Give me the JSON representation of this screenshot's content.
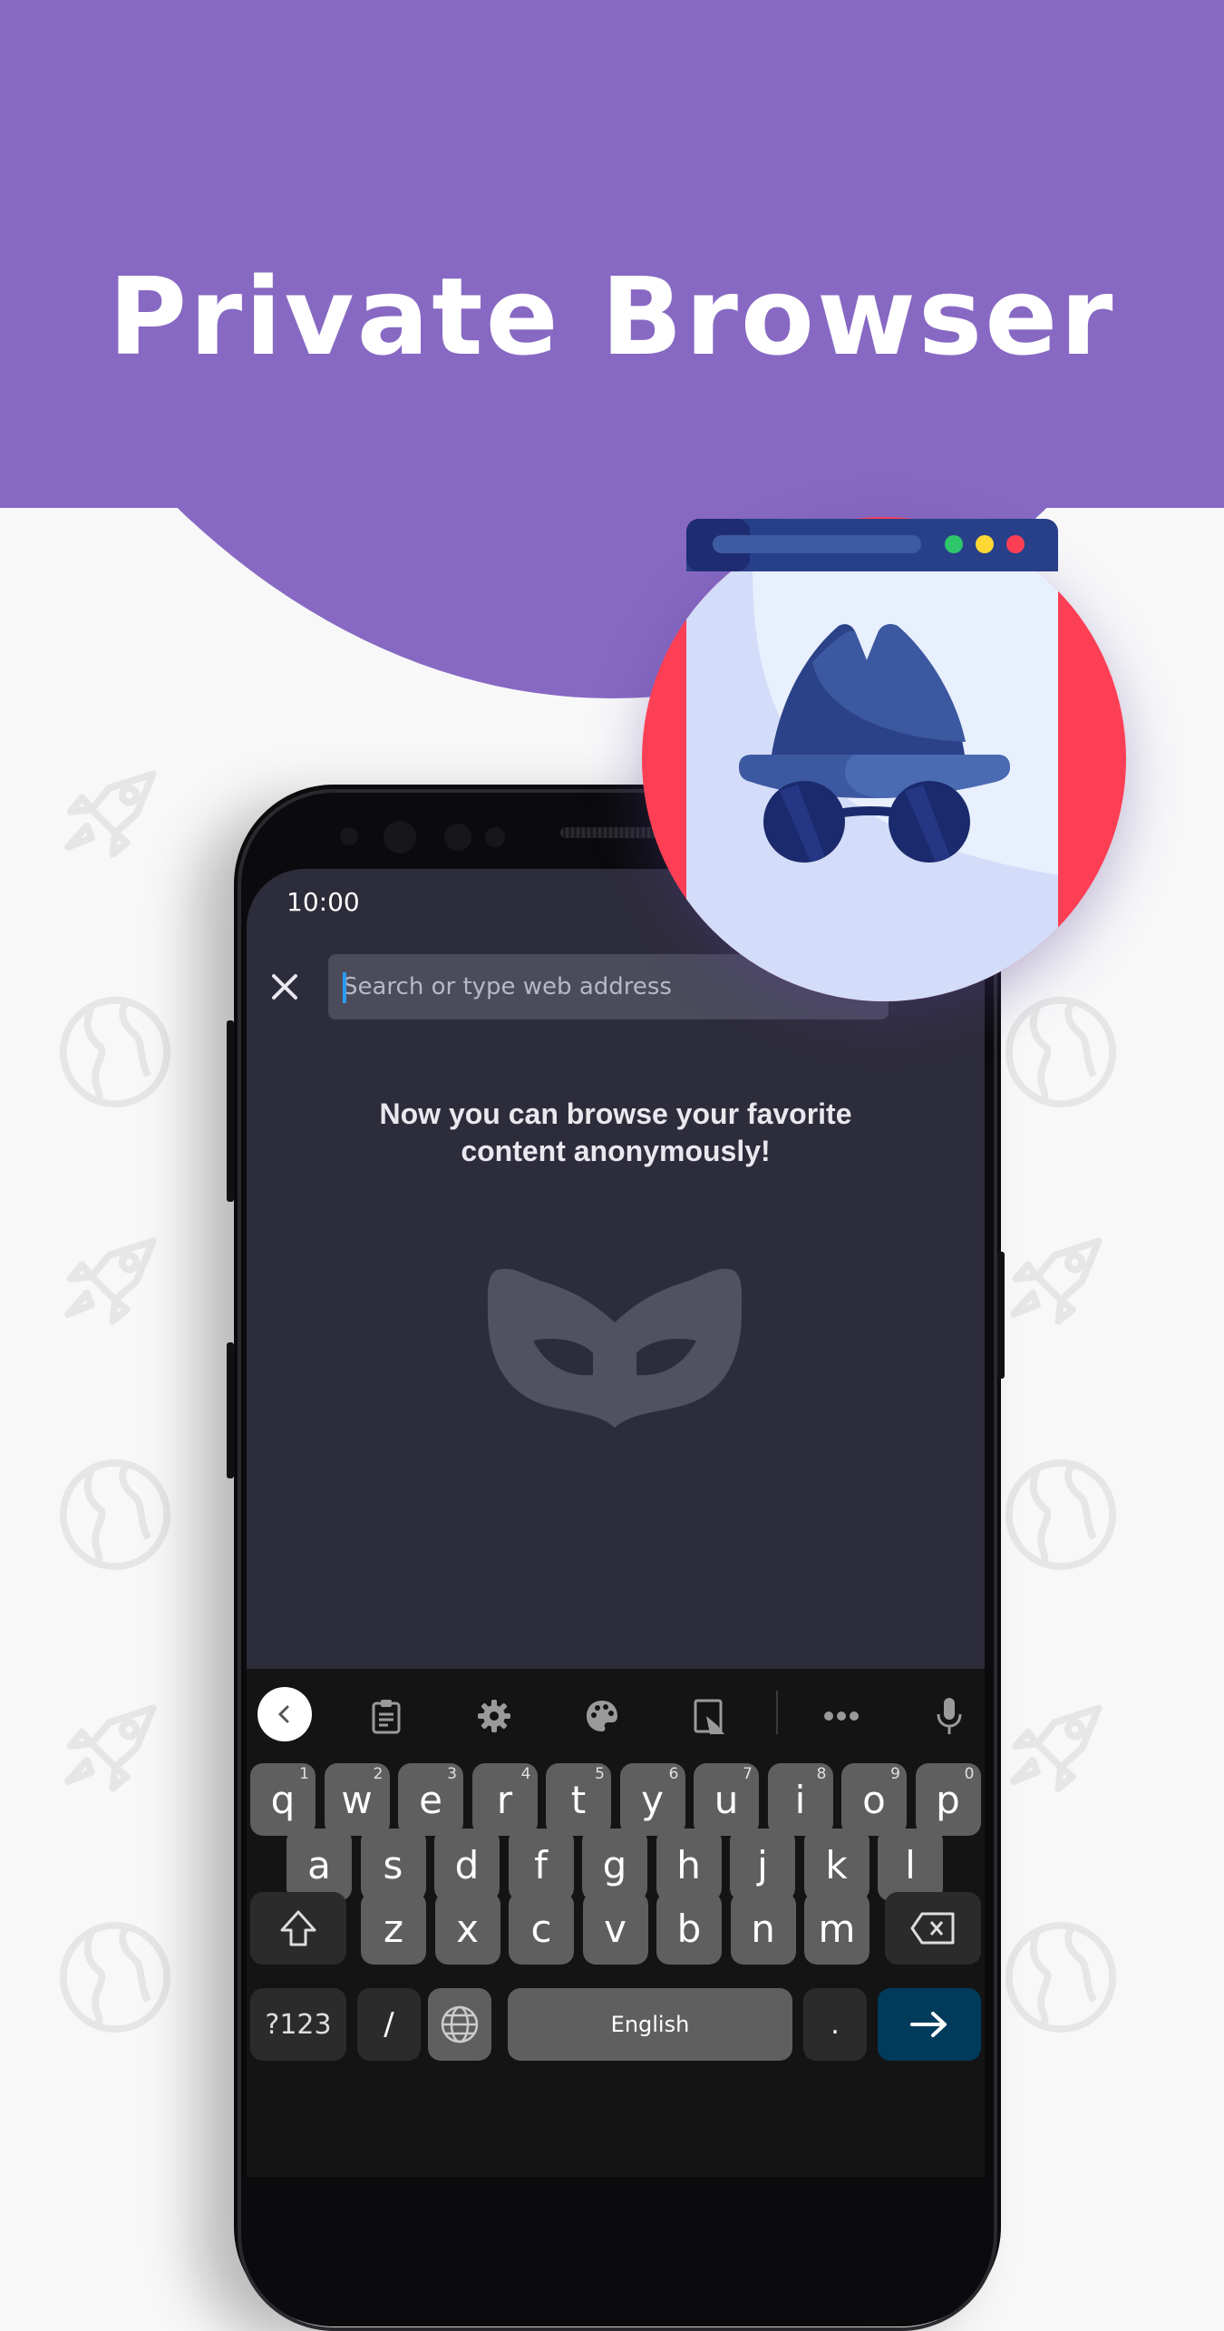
{
  "header": {
    "title": "Private Browser",
    "background_color": "#8769c3"
  },
  "phone": {
    "status_bar": {
      "time": "10:00"
    },
    "address_bar": {
      "close_icon": "close-icon",
      "placeholder": "Search or type web address",
      "value": ""
    },
    "message": {
      "line1": "Now you can browse your favorite",
      "line2": "content anonymously!"
    },
    "illustration": "incognito-mask-icon"
  },
  "keyboard": {
    "toolbar": [
      {
        "name": "back",
        "icon": "chevron-left-icon"
      },
      {
        "name": "clipboard",
        "icon": "clipboard-icon"
      },
      {
        "name": "settings",
        "icon": "gear-icon"
      },
      {
        "name": "theme",
        "icon": "palette-icon"
      },
      {
        "name": "one-handed",
        "icon": "one-hand-mode-icon"
      },
      {
        "name": "more",
        "icon": "more-horizontal-icon"
      },
      {
        "name": "voice",
        "icon": "microphone-icon"
      }
    ],
    "row1": [
      {
        "k": "q",
        "n": "1"
      },
      {
        "k": "w",
        "n": "2"
      },
      {
        "k": "e",
        "n": "3"
      },
      {
        "k": "r",
        "n": "4"
      },
      {
        "k": "t",
        "n": "5"
      },
      {
        "k": "y",
        "n": "6"
      },
      {
        "k": "u",
        "n": "7"
      },
      {
        "k": "i",
        "n": "8"
      },
      {
        "k": "o",
        "n": "9"
      },
      {
        "k": "p",
        "n": "0"
      }
    ],
    "row2": [
      "a",
      "s",
      "d",
      "f",
      "g",
      "h",
      "j",
      "k",
      "l"
    ],
    "row3": [
      "z",
      "x",
      "c",
      "v",
      "b",
      "n",
      "m"
    ],
    "symbols_label": "?123",
    "slash_label": "/",
    "space_label": "English",
    "period_label": ".",
    "accent_color": "#003b5c"
  },
  "badge": {
    "icon": "incognito-browser-icon",
    "window_dots": [
      "#2ec66b",
      "#fdd835",
      "#fd3f56"
    ]
  }
}
